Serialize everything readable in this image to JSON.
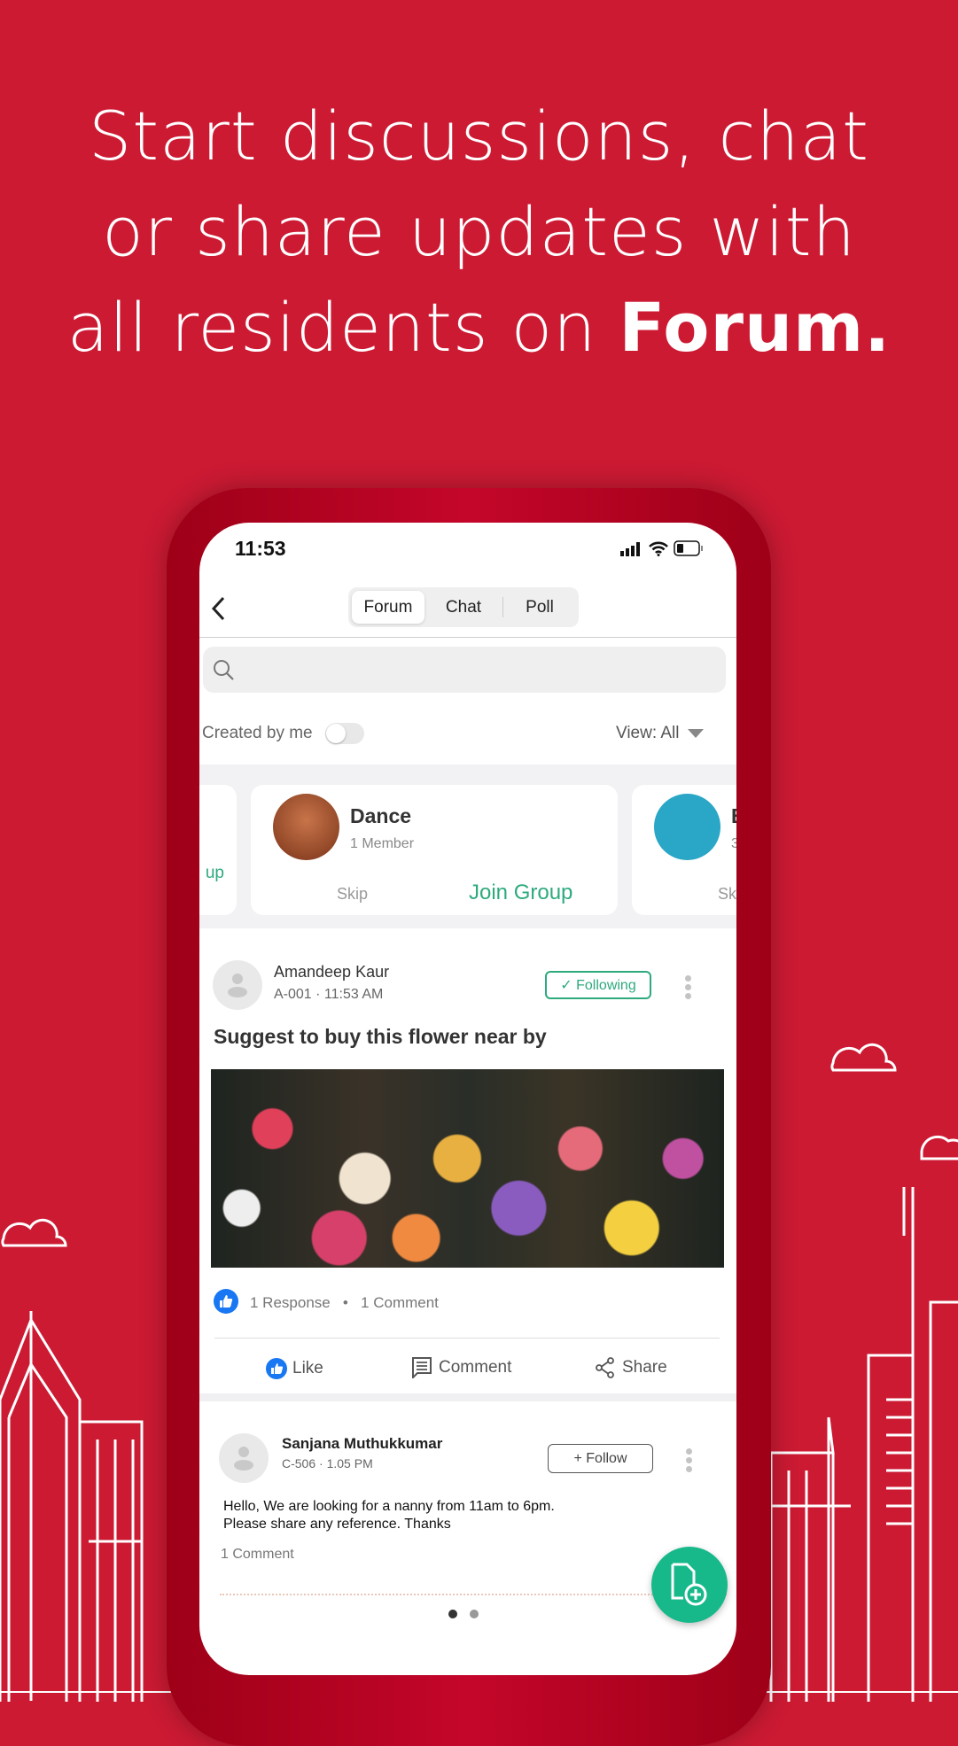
{
  "headline": {
    "line1": "Start discussions, chat",
    "line2": "or share updates with",
    "line3_prefix": "all residents on ",
    "line3_bold": "Forum."
  },
  "status_bar": {
    "time": "11:53",
    "icons": [
      "signal-icon",
      "wifi-icon",
      "battery-icon"
    ]
  },
  "nav": {
    "back_icon": "chevron-left-icon",
    "tabs": [
      {
        "label": "Forum",
        "active": true
      },
      {
        "label": "Chat",
        "active": false
      },
      {
        "label": "Poll",
        "active": false
      }
    ]
  },
  "search": {
    "placeholder": "",
    "value": ""
  },
  "filters": {
    "created_by_me_label": "Created by me",
    "created_by_me_on": false,
    "view_label": "View: All"
  },
  "groups": {
    "prev_card_action": "up",
    "cards": [
      {
        "name": "Dance",
        "members": "1 Member",
        "skip": "Skip",
        "join": "Join Group"
      },
      {
        "name": "B",
        "members": "3",
        "skip": "Sk"
      }
    ]
  },
  "posts": [
    {
      "author": "Amandeep Kaur",
      "unit": "A-001",
      "time": "11:53 AM",
      "follow_label": "✓ Following",
      "title": "Suggest to buy this flower near by",
      "responses": "1 Response",
      "comments": "1 Comment",
      "actions": {
        "like": "Like",
        "comment": "Comment",
        "share": "Share"
      }
    },
    {
      "author": "Sanjana Muthukkumar",
      "unit": "C-506",
      "time": "1.05 PM",
      "follow_label": "+ Follow",
      "body_line1": "Hello, We are looking for a nanny from 11am to 6pm.",
      "body_line2": "Please share any reference. Thanks",
      "comments": "1 Comment"
    }
  ],
  "pager": {
    "pages": 2,
    "current": 1
  },
  "colors": {
    "background": "#cc1a33",
    "accent_green": "#2eaa7d",
    "like_blue": "#1877f2"
  }
}
